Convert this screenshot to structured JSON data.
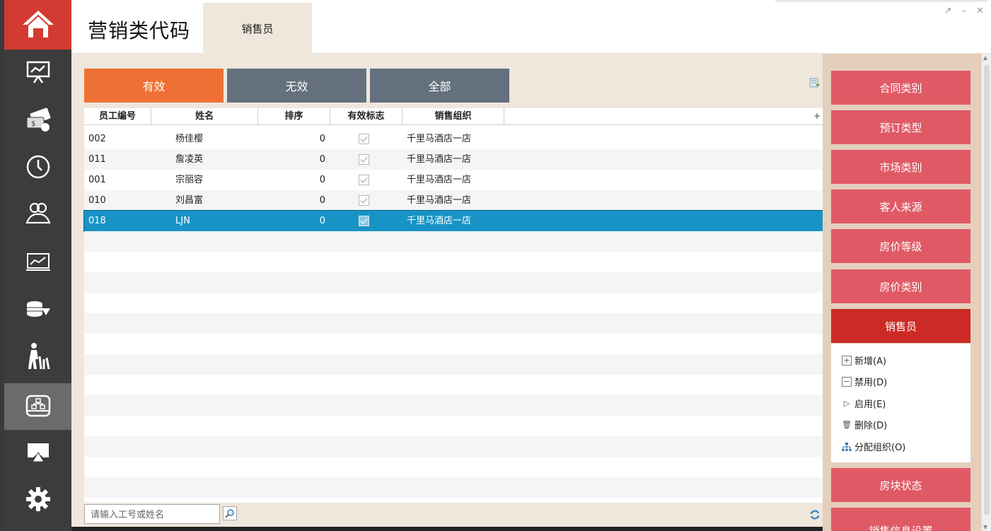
{
  "app": {
    "title": "营销类代码",
    "active_tab": "销售员"
  },
  "window_controls": [
    "restore-icon",
    "minimize-icon",
    "close-icon"
  ],
  "rail": {
    "items": [
      "home-icon",
      "presentation-chart-icon",
      "money-icon",
      "clock-icon",
      "users-icon",
      "trend-chart-icon",
      "coins-download-icon",
      "walking-person-icon",
      "org-chart-drive-icon",
      "monitor-share-icon",
      "gear-icon"
    ],
    "active_index": 8
  },
  "filters": {
    "valid": "有效",
    "invalid": "无效",
    "all": "全部"
  },
  "table": {
    "columns": [
      "员工编号",
      "姓名",
      "排序",
      "有效标志",
      "销售组织"
    ],
    "rows": [
      {
        "id": "002",
        "name": "杨佳樱",
        "sort": "0",
        "valid": true,
        "org": "千里马酒店一店"
      },
      {
        "id": "011",
        "name": "詹凌英",
        "sort": "0",
        "valid": true,
        "org": "千里马酒店一店"
      },
      {
        "id": "001",
        "name": "宗丽容",
        "sort": "0",
        "valid": true,
        "org": "千里马酒店一店"
      },
      {
        "id": "010",
        "name": "刘昌富",
        "sort": "0",
        "valid": true,
        "org": "千里马酒店一店"
      },
      {
        "id": "018",
        "name": "LJN",
        "sort": "0",
        "valid": true,
        "org": "千里马酒店一店"
      }
    ],
    "selected_row": 4,
    "column_chooser": "+"
  },
  "search": {
    "placeholder": "请输入工号或姓名"
  },
  "side": {
    "buttons": [
      "合同类别",
      "预订类型",
      "市场类别",
      "客人来源",
      "房价等级",
      "房价类别",
      "销售员",
      "房块状态",
      "销售信息设置"
    ],
    "active_button": "销售员",
    "actions": [
      {
        "label": "新增(A)",
        "icon": "plus-box-icon"
      },
      {
        "label": "禁用(D)",
        "icon": "minus-box-icon"
      },
      {
        "label": "启用(E)",
        "icon": "play-triangle-icon"
      },
      {
        "label": "删除(D)",
        "icon": "trash-icon"
      },
      {
        "label": "分配组织(O)",
        "icon": "org-tree-icon"
      }
    ]
  },
  "colors": {
    "accent_orange": "#ef7034",
    "filter_gray": "#64707e",
    "side_button": "#e05a65",
    "side_button_active": "#cc2a25",
    "home_red": "#d33a31",
    "selection_blue": "#1893c5",
    "panel_beige": "#efe6dc"
  }
}
